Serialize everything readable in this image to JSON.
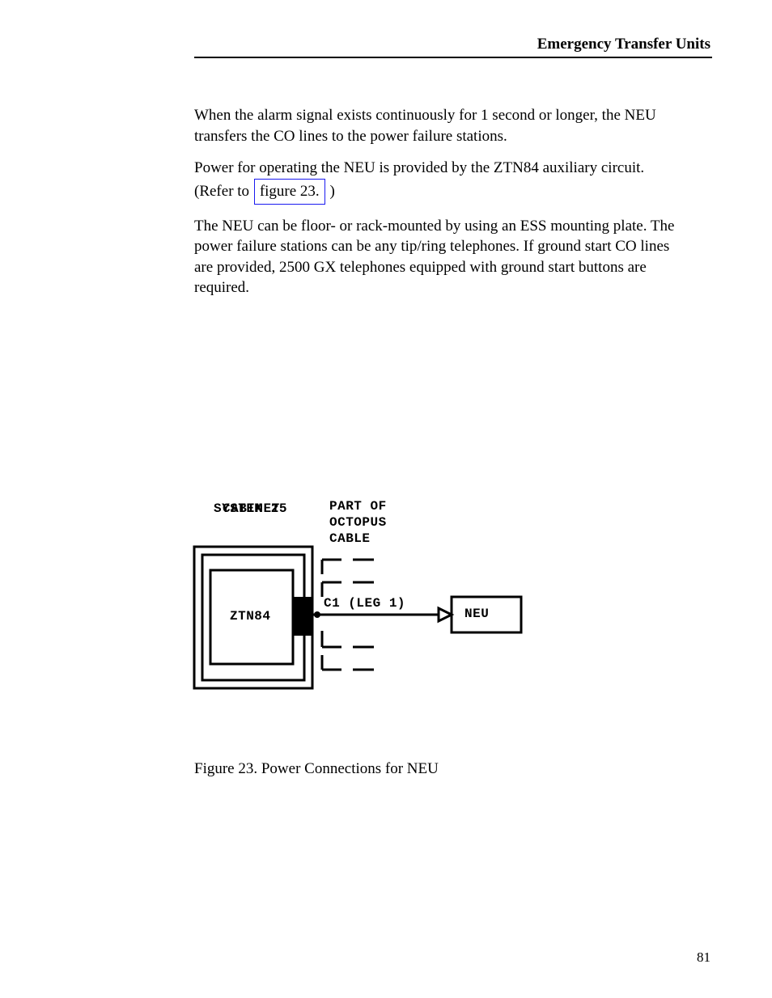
{
  "header": {
    "title_right": "Emergency Transfer Units"
  },
  "body": {
    "p1": "When the alarm signal exists continuously for 1 second or longer, the NEU transfers the CO lines to the power failure stations.",
    "p2a": "Power for operating the NEU is provided by the ZTN84 auxiliary circuit. (Refer to ",
    "p2_link": "figure 23.",
    "p2b": " )",
    "p3": "The NEU can be floor- or rack-mounted by using an ESS mounting plate. The power failure stations can be any tip/ring telephones. If ground start CO lines are provided, 2500 GX telephones equipped with ground start buttons are required."
  },
  "figure": {
    "labels": {
      "sys25_l1": "SYSTEM 25",
      "sys25_l2": "CABINET",
      "part_l1": "PART OF",
      "part_l2": "OCTOPUS",
      "part_l3": "CABLE",
      "chip": "ZTN84",
      "leg": "C1 (LEG 1)",
      "neu": "NEU"
    },
    "caption": "Figure 23. Power Connections for NEU"
  },
  "page_number": "81"
}
